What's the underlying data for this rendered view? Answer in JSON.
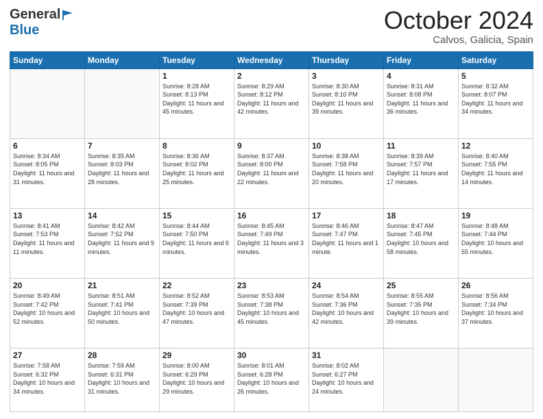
{
  "header": {
    "logo_general": "General",
    "logo_blue": "Blue",
    "month_title": "October 2024",
    "subtitle": "Calvos, Galicia, Spain"
  },
  "days_of_week": [
    "Sunday",
    "Monday",
    "Tuesday",
    "Wednesday",
    "Thursday",
    "Friday",
    "Saturday"
  ],
  "weeks": [
    [
      {
        "day": "",
        "info": ""
      },
      {
        "day": "",
        "info": ""
      },
      {
        "day": "1",
        "info": "Sunrise: 8:28 AM\nSunset: 8:13 PM\nDaylight: 11 hours and 45 minutes."
      },
      {
        "day": "2",
        "info": "Sunrise: 8:29 AM\nSunset: 8:12 PM\nDaylight: 11 hours and 42 minutes."
      },
      {
        "day": "3",
        "info": "Sunrise: 8:30 AM\nSunset: 8:10 PM\nDaylight: 11 hours and 39 minutes."
      },
      {
        "day": "4",
        "info": "Sunrise: 8:31 AM\nSunset: 8:08 PM\nDaylight: 11 hours and 36 minutes."
      },
      {
        "day": "5",
        "info": "Sunrise: 8:32 AM\nSunset: 8:07 PM\nDaylight: 11 hours and 34 minutes."
      }
    ],
    [
      {
        "day": "6",
        "info": "Sunrise: 8:34 AM\nSunset: 8:05 PM\nDaylight: 11 hours and 31 minutes."
      },
      {
        "day": "7",
        "info": "Sunrise: 8:35 AM\nSunset: 8:03 PM\nDaylight: 11 hours and 28 minutes."
      },
      {
        "day": "8",
        "info": "Sunrise: 8:36 AM\nSunset: 8:02 PM\nDaylight: 11 hours and 25 minutes."
      },
      {
        "day": "9",
        "info": "Sunrise: 8:37 AM\nSunset: 8:00 PM\nDaylight: 11 hours and 22 minutes."
      },
      {
        "day": "10",
        "info": "Sunrise: 8:38 AM\nSunset: 7:58 PM\nDaylight: 11 hours and 20 minutes."
      },
      {
        "day": "11",
        "info": "Sunrise: 8:39 AM\nSunset: 7:57 PM\nDaylight: 11 hours and 17 minutes."
      },
      {
        "day": "12",
        "info": "Sunrise: 8:40 AM\nSunset: 7:55 PM\nDaylight: 11 hours and 14 minutes."
      }
    ],
    [
      {
        "day": "13",
        "info": "Sunrise: 8:41 AM\nSunset: 7:53 PM\nDaylight: 11 hours and 11 minutes."
      },
      {
        "day": "14",
        "info": "Sunrise: 8:42 AM\nSunset: 7:52 PM\nDaylight: 11 hours and 9 minutes."
      },
      {
        "day": "15",
        "info": "Sunrise: 8:44 AM\nSunset: 7:50 PM\nDaylight: 11 hours and 6 minutes."
      },
      {
        "day": "16",
        "info": "Sunrise: 8:45 AM\nSunset: 7:49 PM\nDaylight: 11 hours and 3 minutes."
      },
      {
        "day": "17",
        "info": "Sunrise: 8:46 AM\nSunset: 7:47 PM\nDaylight: 11 hours and 1 minute."
      },
      {
        "day": "18",
        "info": "Sunrise: 8:47 AM\nSunset: 7:45 PM\nDaylight: 10 hours and 58 minutes."
      },
      {
        "day": "19",
        "info": "Sunrise: 8:48 AM\nSunset: 7:44 PM\nDaylight: 10 hours and 55 minutes."
      }
    ],
    [
      {
        "day": "20",
        "info": "Sunrise: 8:49 AM\nSunset: 7:42 PM\nDaylight: 10 hours and 52 minutes."
      },
      {
        "day": "21",
        "info": "Sunrise: 8:51 AM\nSunset: 7:41 PM\nDaylight: 10 hours and 50 minutes."
      },
      {
        "day": "22",
        "info": "Sunrise: 8:52 AM\nSunset: 7:39 PM\nDaylight: 10 hours and 47 minutes."
      },
      {
        "day": "23",
        "info": "Sunrise: 8:53 AM\nSunset: 7:38 PM\nDaylight: 10 hours and 45 minutes."
      },
      {
        "day": "24",
        "info": "Sunrise: 8:54 AM\nSunset: 7:36 PM\nDaylight: 10 hours and 42 minutes."
      },
      {
        "day": "25",
        "info": "Sunrise: 8:55 AM\nSunset: 7:35 PM\nDaylight: 10 hours and 39 minutes."
      },
      {
        "day": "26",
        "info": "Sunrise: 8:56 AM\nSunset: 7:34 PM\nDaylight: 10 hours and 37 minutes."
      }
    ],
    [
      {
        "day": "27",
        "info": "Sunrise: 7:58 AM\nSunset: 6:32 PM\nDaylight: 10 hours and 34 minutes."
      },
      {
        "day": "28",
        "info": "Sunrise: 7:59 AM\nSunset: 6:31 PM\nDaylight: 10 hours and 31 minutes."
      },
      {
        "day": "29",
        "info": "Sunrise: 8:00 AM\nSunset: 6:29 PM\nDaylight: 10 hours and 29 minutes."
      },
      {
        "day": "30",
        "info": "Sunrise: 8:01 AM\nSunset: 6:28 PM\nDaylight: 10 hours and 26 minutes."
      },
      {
        "day": "31",
        "info": "Sunrise: 8:02 AM\nSunset: 6:27 PM\nDaylight: 10 hours and 24 minutes."
      },
      {
        "day": "",
        "info": ""
      },
      {
        "day": "",
        "info": ""
      }
    ]
  ]
}
